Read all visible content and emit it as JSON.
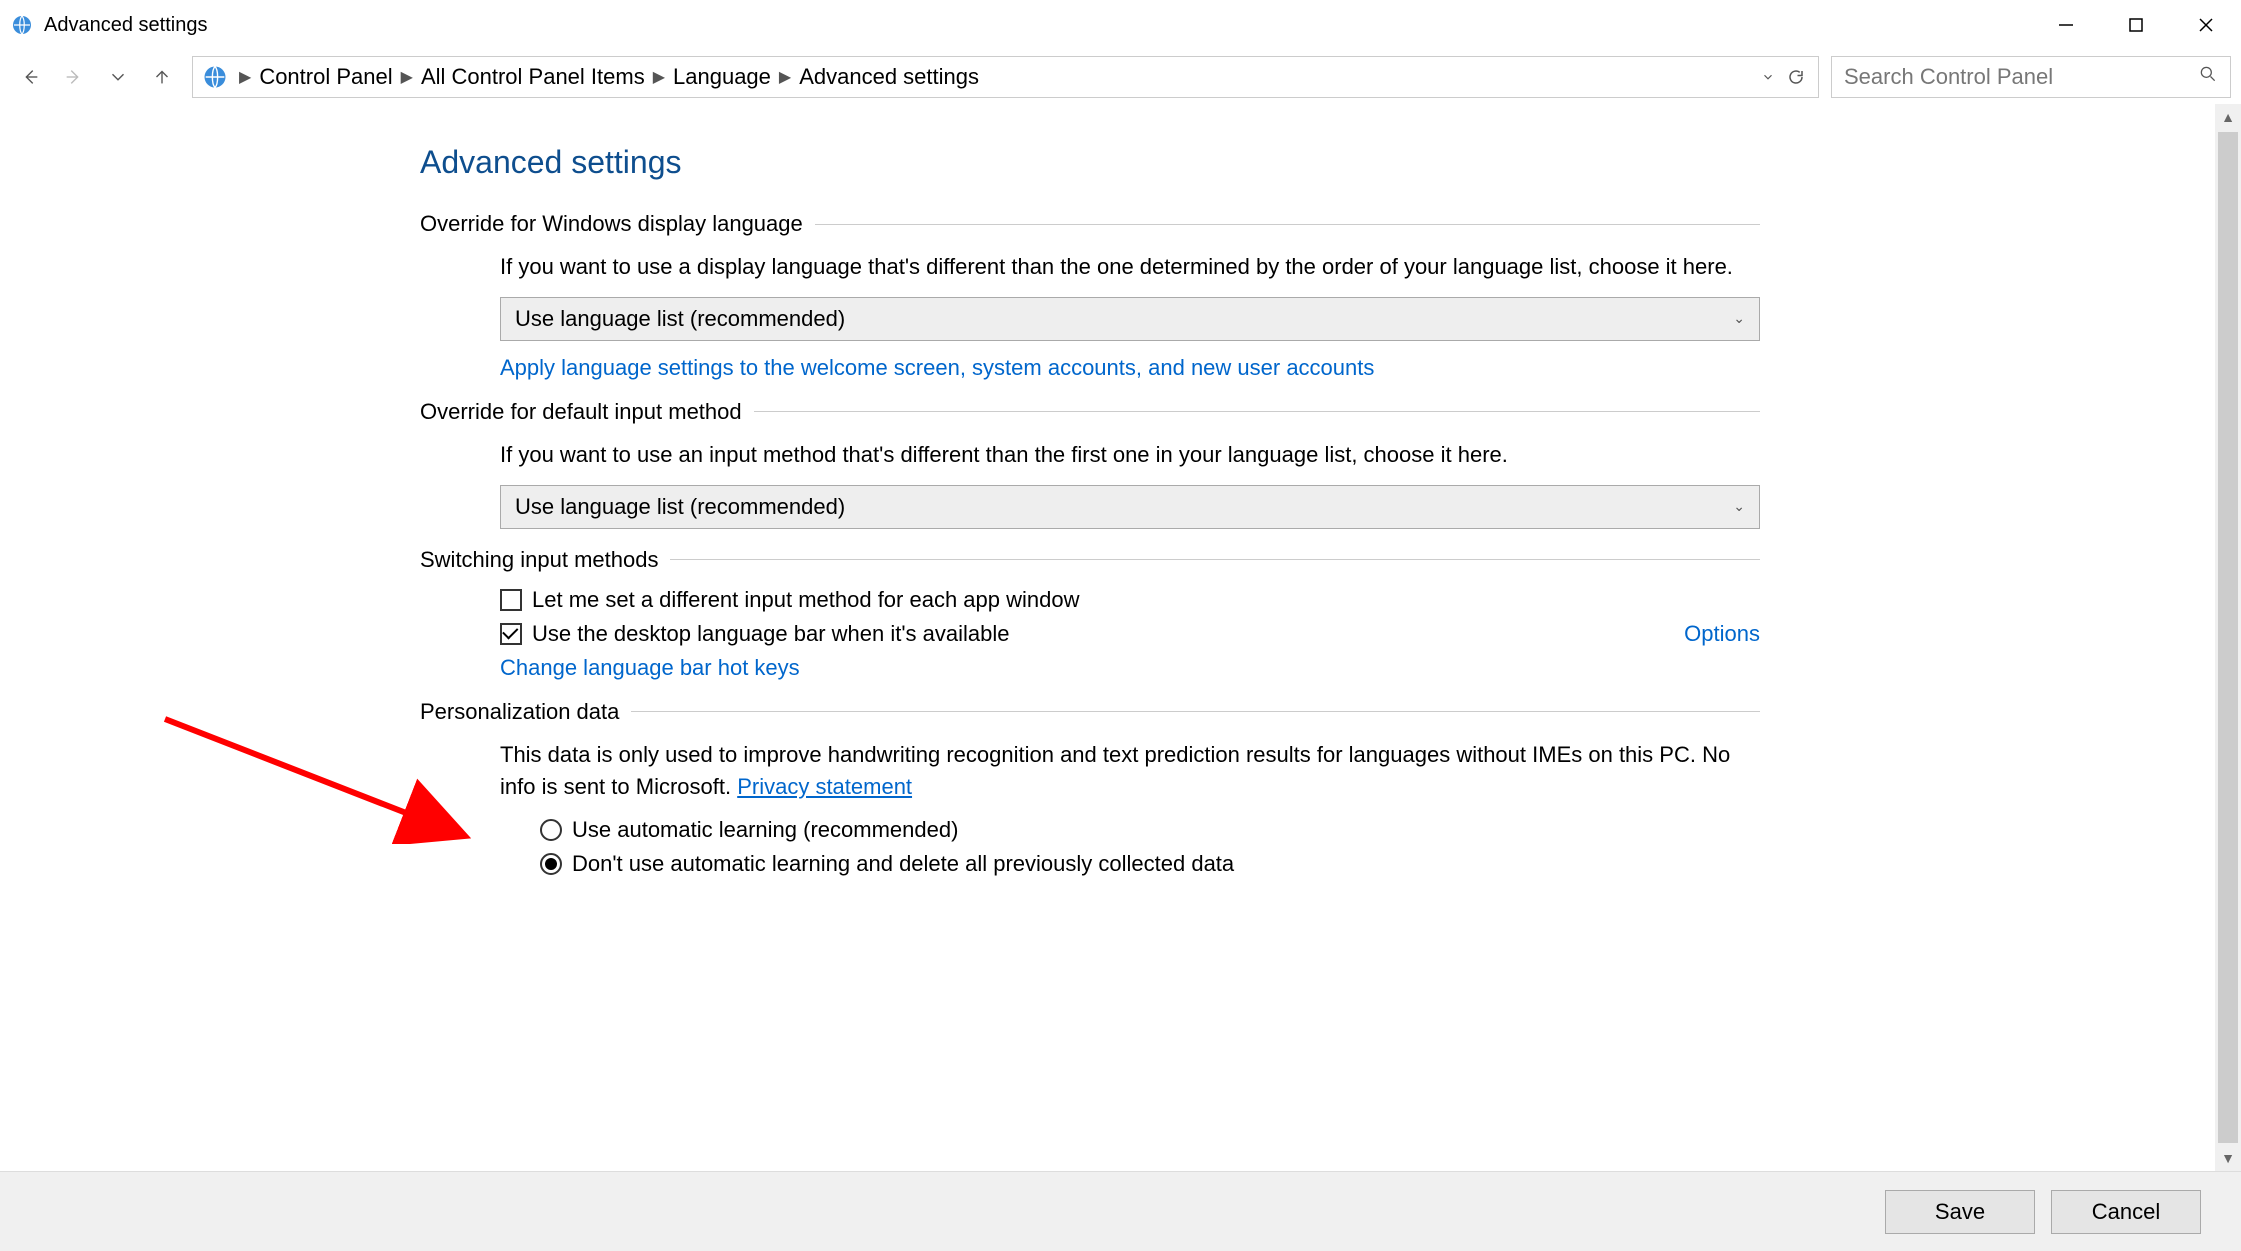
{
  "window": {
    "title": "Advanced settings"
  },
  "breadcrumbs": {
    "items": [
      "Control Panel",
      "All Control Panel Items",
      "Language",
      "Advanced settings"
    ]
  },
  "search": {
    "placeholder": "Search Control Panel"
  },
  "page": {
    "heading": "Advanced settings",
    "sec1": {
      "title": "Override for Windows display language",
      "desc": "If you want to use a display language that's different than the one determined by the order of your language list, choose it here.",
      "dropdown": "Use language list (recommended)",
      "link": "Apply language settings to the welcome screen, system accounts, and new user accounts"
    },
    "sec2": {
      "title": "Override for default input method",
      "desc": "If you want to use an input method that's different than the first one in your language list, choose it here.",
      "dropdown": "Use language list (recommended)"
    },
    "sec3": {
      "title": "Switching input methods",
      "cb1": "Let me set a different input method for each app window",
      "cb2": "Use the desktop language bar when it's available",
      "options": "Options",
      "hotkeys": "Change language bar hot keys"
    },
    "sec4": {
      "title": "Personalization data",
      "desc": "This data is only used to improve handwriting recognition and text prediction results for languages without IMEs on this PC. No info is sent to Microsoft. ",
      "privacy": "Privacy statement",
      "r1": "Use automatic learning (recommended)",
      "r2": "Don't use automatic learning and delete all previously collected data"
    }
  },
  "footer": {
    "save": "Save",
    "cancel": "Cancel"
  }
}
